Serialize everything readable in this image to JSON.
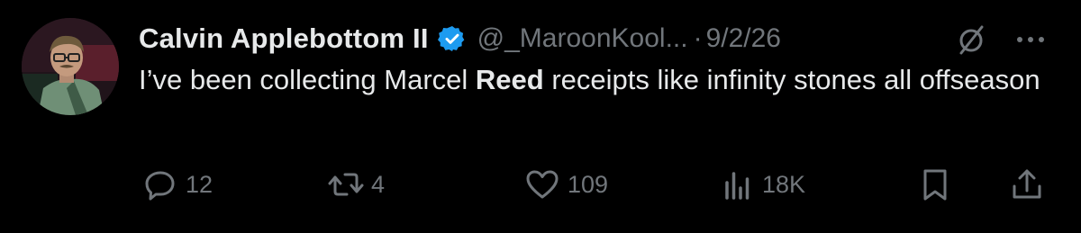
{
  "tweet": {
    "display_name": "Calvin Applebottom II",
    "handle": "@_MaroonKool...",
    "separator": "·",
    "date": "9/2/26",
    "text_before": "I’ve been collecting Marcel ",
    "text_bold": "Reed",
    "text_after": " receipts like infinity stones all offseason"
  },
  "actions": {
    "replies": "12",
    "reposts": "4",
    "likes": "109",
    "views": "18K"
  },
  "icons": {
    "verified": "verified-badge-icon",
    "grok": "grok-icon",
    "more": "more-horizontal-icon",
    "reply": "reply-icon",
    "repost": "repost-icon",
    "like": "heart-icon",
    "views": "views-chart-icon",
    "bookmark": "bookmark-icon",
    "share": "share-icon"
  },
  "colors": {
    "background": "#000000",
    "text_primary": "#e7e9ea",
    "text_secondary": "#71767b",
    "verified_blue": "#1d9bf0"
  }
}
